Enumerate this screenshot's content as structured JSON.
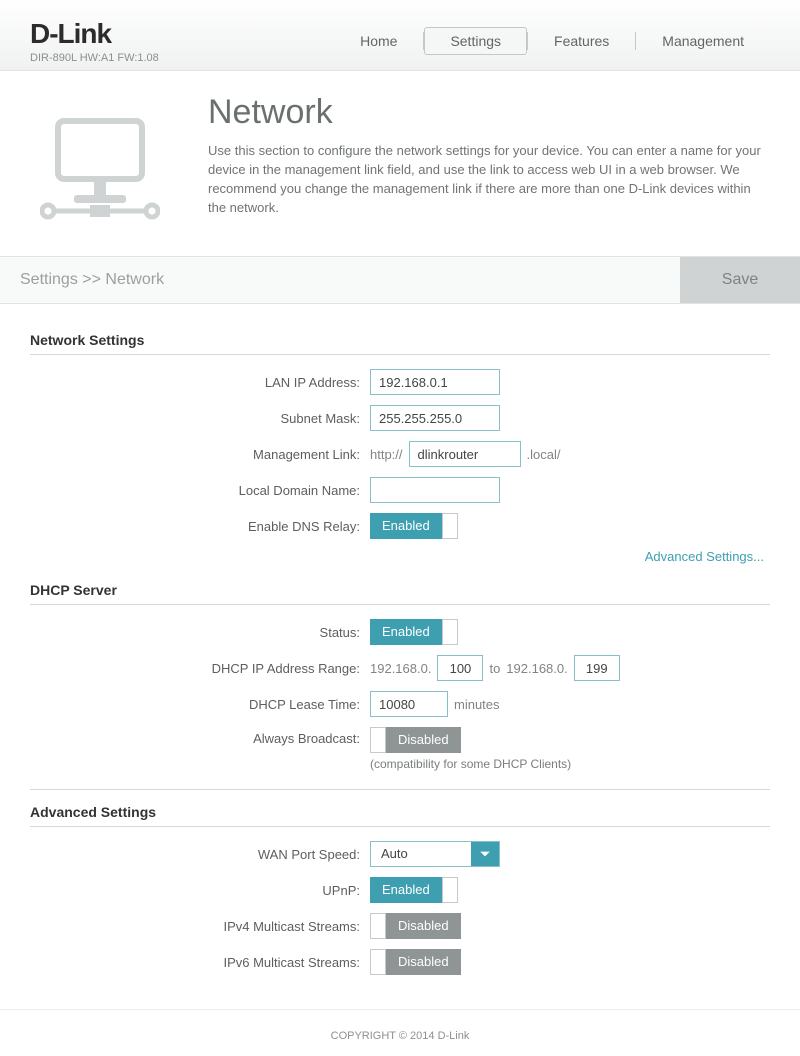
{
  "header": {
    "brand": "D-Link",
    "model_line": "DIR-890L   HW:A1   FW:1.08",
    "nav": [
      "Home",
      "Settings",
      "Features",
      "Management"
    ],
    "active_nav_index": 1
  },
  "hero": {
    "title": "Network",
    "description": "Use this section to configure the network settings for your device. You can enter a name for your device in the management link field, and use the link to access web UI in a web browser. We recommend you change the management link if there are more than one D-Link devices within the network."
  },
  "crumb": {
    "path": "Settings >> Network",
    "save_label": "Save"
  },
  "network_settings": {
    "section_title": "Network Settings",
    "lan_ip_label": "LAN IP Address:",
    "lan_ip_value": "192.168.0.1",
    "subnet_label": "Subnet Mask:",
    "subnet_value": "255.255.255.0",
    "mgmt_label": "Management Link:",
    "mgmt_prefix": "http://",
    "mgmt_host": "dlinkrouter",
    "mgmt_suffix": ".local/",
    "local_domain_label": "Local Domain Name:",
    "local_domain_value": "",
    "dns_relay_label": "Enable DNS Relay:",
    "dns_relay_state": "Enabled",
    "advanced_link": "Advanced Settings..."
  },
  "dhcp": {
    "section_title": "DHCP Server",
    "status_label": "Status:",
    "status_state": "Enabled",
    "range_label": "DHCP IP Address Range:",
    "range_prefix1": "192.168.0.",
    "range_start": "100",
    "range_to": "to",
    "range_prefix2": "192.168.0.",
    "range_end": "199",
    "lease_label": "DHCP Lease Time:",
    "lease_value": "10080",
    "lease_unit": "minutes",
    "always_bcast_label": "Always Broadcast:",
    "always_bcast_state": "Disabled",
    "always_bcast_hint": "(compatibility for some DHCP Clients)"
  },
  "advanced": {
    "section_title": "Advanced Settings",
    "wan_speed_label": "WAN Port Speed:",
    "wan_speed_value": "Auto",
    "upnp_label": "UPnP:",
    "upnp_state": "Enabled",
    "ipv4mc_label": "IPv4 Multicast Streams:",
    "ipv4mc_state": "Disabled",
    "ipv6mc_label": "IPv6 Multicast Streams:",
    "ipv6mc_state": "Disabled"
  },
  "footer": {
    "copyright": "COPYRIGHT © 2014 D-Link"
  }
}
